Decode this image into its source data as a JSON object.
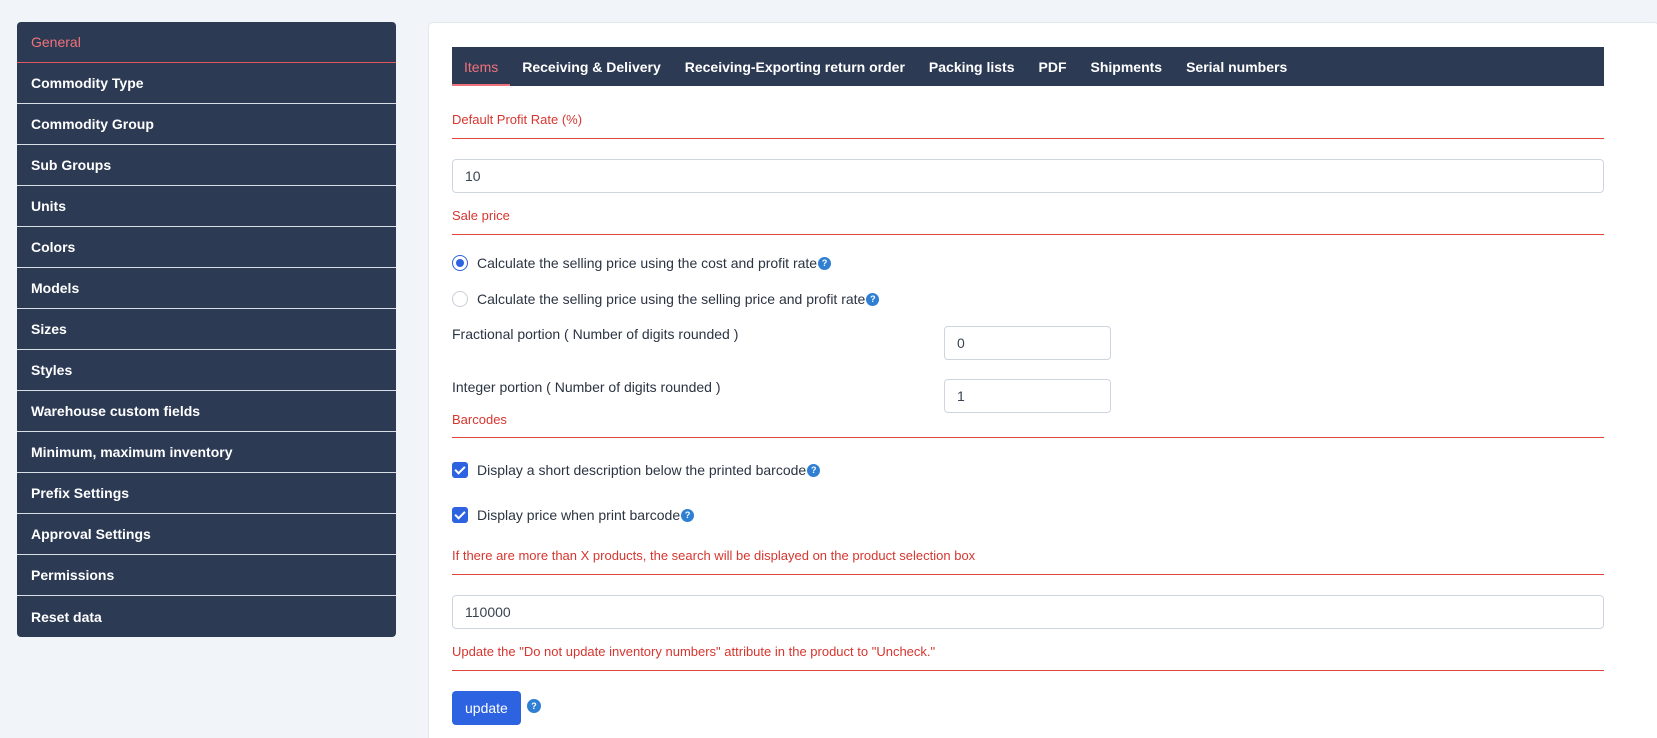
{
  "sidebar": {
    "items": [
      {
        "label": "General"
      },
      {
        "label": "Commodity Type"
      },
      {
        "label": "Commodity Group"
      },
      {
        "label": "Sub Groups"
      },
      {
        "label": "Units"
      },
      {
        "label": "Colors"
      },
      {
        "label": "Models"
      },
      {
        "label": "Sizes"
      },
      {
        "label": "Styles"
      },
      {
        "label": "Warehouse custom fields"
      },
      {
        "label": "Minimum, maximum inventory"
      },
      {
        "label": "Prefix Settings"
      },
      {
        "label": "Approval Settings"
      },
      {
        "label": "Permissions"
      },
      {
        "label": "Reset data"
      }
    ]
  },
  "tabs": [
    {
      "label": "Items"
    },
    {
      "label": "Receiving & Delivery"
    },
    {
      "label": "Receiving-Exporting return order"
    },
    {
      "label": "Packing lists"
    },
    {
      "label": "PDF"
    },
    {
      "label": "Shipments"
    },
    {
      "label": "Serial numbers"
    }
  ],
  "profit": {
    "label": "Default Profit Rate (%)",
    "value": "10"
  },
  "sale_price": {
    "label": "Sale price",
    "option1": "Calculate the selling price using the cost and profit rate",
    "option2": "Calculate the selling price using the selling price and profit rate",
    "fractional_label": "Fractional portion ( Number of digits rounded )",
    "fractional_value": "0",
    "integer_label": "Integer portion ( Number of digits rounded )",
    "integer_value": "1"
  },
  "barcodes": {
    "label": "Barcodes",
    "check1": "Display a short description below the printed barcode",
    "check2": "Display price when print barcode"
  },
  "search_threshold": {
    "label": "If there are more than X products, the search will be displayed on the product selection box",
    "value": "110000"
  },
  "update_attr": {
    "label": "Update the \"Do not update inventory numbers\" attribute in the product to \"Uncheck.\""
  },
  "buttons": {
    "update": "update",
    "help_glyph": "?"
  },
  "colors": {
    "sidebar_bg": "#2c3a54",
    "accent_red": "#d6362f",
    "active_tab": "#f0727a",
    "primary_blue": "#2d62e0"
  }
}
